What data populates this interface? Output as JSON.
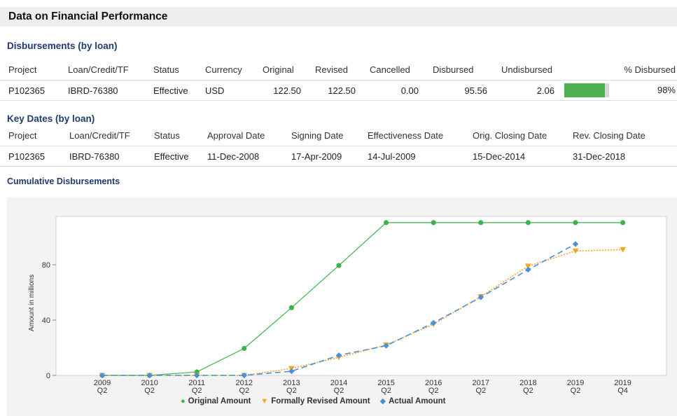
{
  "page_title": "Data on Financial Performance",
  "disbursements": {
    "title": "Disbursements (by loan)",
    "headers": [
      "Project",
      "Loan/Credit/TF",
      "Status",
      "Currency",
      "Original",
      "Revised",
      "Cancelled",
      "Disbursed",
      "Undisbursed",
      "% Disbursed"
    ],
    "rows": [
      {
        "project": "P102365",
        "loan": "IBRD-76380",
        "status": "Effective",
        "currency": "USD",
        "original": "122.50",
        "revised": "122.50",
        "cancelled": "0.00",
        "disbursed": "95.56",
        "undisbursed": "2.06",
        "pct_disbursed": "98%",
        "pct_fraction": 0.98
      }
    ]
  },
  "key_dates": {
    "title": "Key Dates (by loan)",
    "headers": [
      "Project",
      "Loan/Credit/TF",
      "Status",
      "Approval Date",
      "Signing Date",
      "Effectiveness Date",
      "Orig. Closing Date",
      "Rev. Closing Date"
    ],
    "rows": [
      {
        "project": "P102365",
        "loan": "IBRD-76380",
        "status": "Effective",
        "approval": "11-Dec-2008",
        "signing": "17-Apr-2009",
        "effectiveness": "14-Jul-2009",
        "orig_closing": "15-Dec-2014",
        "rev_closing": "31-Dec-2018"
      }
    ]
  },
  "cumulative": {
    "title": "Cumulative Disbursements"
  },
  "colors": {
    "original": "#3cb44b",
    "revised": "#f5a623",
    "actual": "#4a90d9",
    "bar_fill": "#4caf50",
    "section_title": "#1f3c6d"
  },
  "chart_data": {
    "type": "line",
    "title": "",
    "xlabel": "",
    "ylabel": "Amount in millions",
    "ylim": [
      0,
      115
    ],
    "yticks": [
      0,
      40,
      80
    ],
    "categories": [
      "2009 Q2",
      "2010 Q2",
      "2011 Q2",
      "2012 Q2",
      "2013 Q2",
      "2014 Q2",
      "2015 Q2",
      "2016 Q2",
      "2017 Q2",
      "2018 Q2",
      "2019 Q2",
      "2019 Q4"
    ],
    "grid": false,
    "legend_position": "bottom",
    "series": [
      {
        "name": "Original Amount",
        "color": "#3cb44b",
        "marker": "circle",
        "style": "solid",
        "values": [
          0,
          0,
          2.5,
          19.5,
          49,
          79.5,
          110.5,
          110.5,
          110.5,
          110.5,
          110.5,
          110.5
        ]
      },
      {
        "name": "Formally Revised Amount",
        "color": "#f5a623",
        "marker": "triangle-down",
        "style": "dotted",
        "values": [
          0,
          0,
          0,
          0,
          5,
          13,
          22,
          37,
          57,
          79,
          90,
          91
        ]
      },
      {
        "name": "Actual Amount",
        "color": "#4a90d9",
        "marker": "diamond",
        "style": "dashed",
        "values": [
          0,
          0,
          0,
          0,
          3,
          14.5,
          21.5,
          38,
          56.5,
          76.5,
          95,
          null
        ]
      }
    ]
  }
}
